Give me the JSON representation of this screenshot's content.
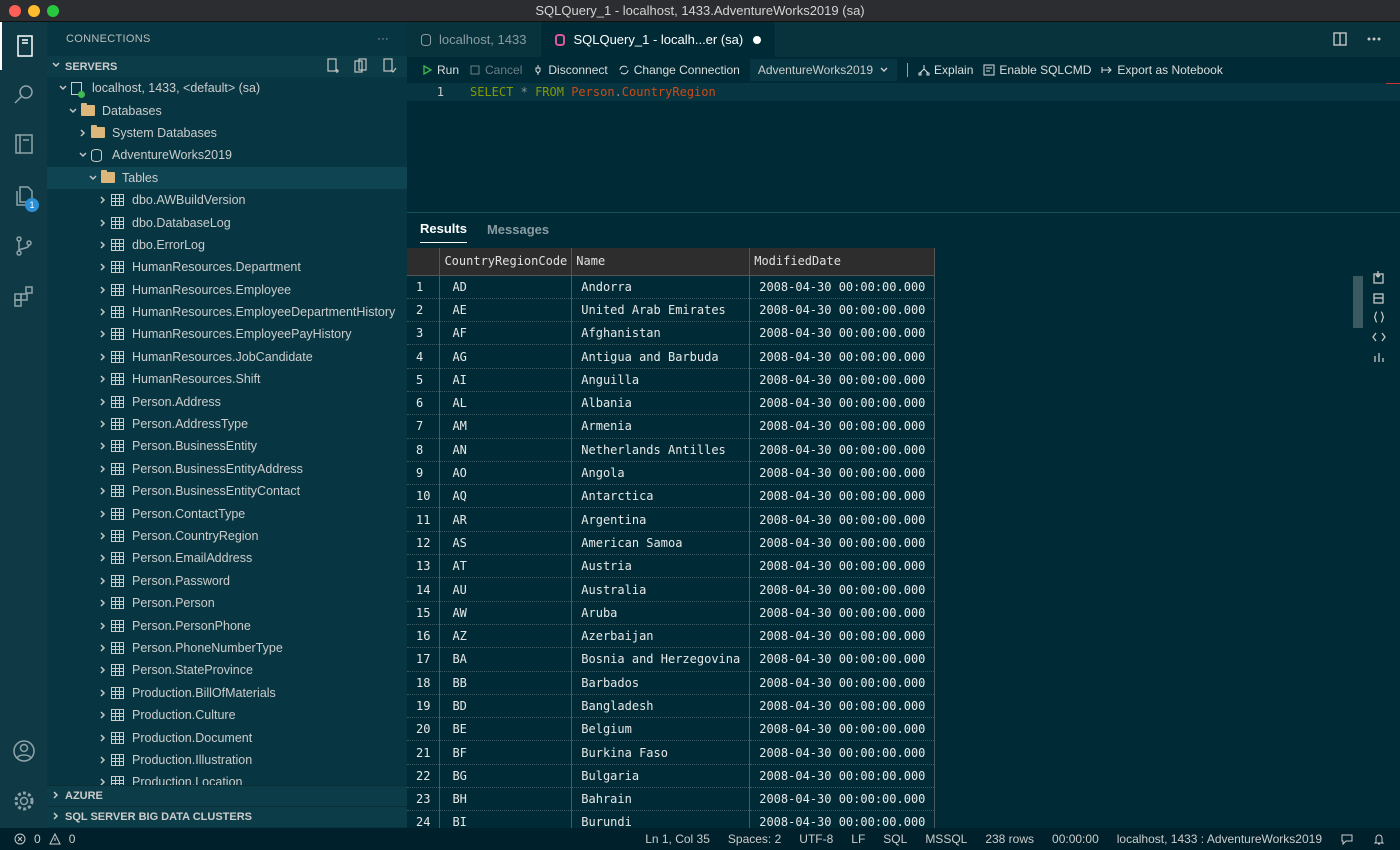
{
  "window": {
    "title": "SQLQuery_1 - localhost, 1433.AdventureWorks2019 (sa)"
  },
  "activity_bar": {
    "items": [
      {
        "name": "connections",
        "icon": "server-icon"
      },
      {
        "name": "search",
        "icon": "search-icon"
      },
      {
        "name": "notebooks",
        "icon": "notebook-icon"
      },
      {
        "name": "explorer",
        "icon": "files-icon",
        "badge": "1"
      },
      {
        "name": "source-control",
        "icon": "source-control-icon"
      },
      {
        "name": "extensions",
        "icon": "extensions-icon"
      }
    ],
    "bottom": [
      {
        "name": "accounts",
        "icon": "account-icon"
      },
      {
        "name": "manage",
        "icon": "gear-icon"
      }
    ]
  },
  "sidebar": {
    "title": "CONNECTIONS",
    "more": "···",
    "servers_label": "SERVERS",
    "tree": [
      {
        "level": 0,
        "twisty": "open",
        "icon": "server",
        "label": "localhost, 1433, <default> (sa)"
      },
      {
        "level": 1,
        "twisty": "open",
        "icon": "folder",
        "label": "Databases"
      },
      {
        "level": 2,
        "twisty": "closed",
        "icon": "folder",
        "label": "System Databases"
      },
      {
        "level": 2,
        "twisty": "open",
        "icon": "db",
        "label": "AdventureWorks2019"
      },
      {
        "level": 3,
        "twisty": "open",
        "icon": "folder",
        "label": "Tables",
        "selected": true
      },
      {
        "level": 4,
        "twisty": "closed",
        "icon": "table",
        "label": "dbo.AWBuildVersion"
      },
      {
        "level": 4,
        "twisty": "closed",
        "icon": "table",
        "label": "dbo.DatabaseLog"
      },
      {
        "level": 4,
        "twisty": "closed",
        "icon": "table",
        "label": "dbo.ErrorLog"
      },
      {
        "level": 4,
        "twisty": "closed",
        "icon": "table",
        "label": "HumanResources.Department"
      },
      {
        "level": 4,
        "twisty": "closed",
        "icon": "table",
        "label": "HumanResources.Employee"
      },
      {
        "level": 4,
        "twisty": "closed",
        "icon": "table",
        "label": "HumanResources.EmployeeDepartmentHistory"
      },
      {
        "level": 4,
        "twisty": "closed",
        "icon": "table",
        "label": "HumanResources.EmployeePayHistory"
      },
      {
        "level": 4,
        "twisty": "closed",
        "icon": "table",
        "label": "HumanResources.JobCandidate"
      },
      {
        "level": 4,
        "twisty": "closed",
        "icon": "table",
        "label": "HumanResources.Shift"
      },
      {
        "level": 4,
        "twisty": "closed",
        "icon": "table",
        "label": "Person.Address"
      },
      {
        "level": 4,
        "twisty": "closed",
        "icon": "table",
        "label": "Person.AddressType"
      },
      {
        "level": 4,
        "twisty": "closed",
        "icon": "table",
        "label": "Person.BusinessEntity"
      },
      {
        "level": 4,
        "twisty": "closed",
        "icon": "table",
        "label": "Person.BusinessEntityAddress"
      },
      {
        "level": 4,
        "twisty": "closed",
        "icon": "table",
        "label": "Person.BusinessEntityContact"
      },
      {
        "level": 4,
        "twisty": "closed",
        "icon": "table",
        "label": "Person.ContactType"
      },
      {
        "level": 4,
        "twisty": "closed",
        "icon": "table",
        "label": "Person.CountryRegion"
      },
      {
        "level": 4,
        "twisty": "closed",
        "icon": "table",
        "label": "Person.EmailAddress"
      },
      {
        "level": 4,
        "twisty": "closed",
        "icon": "table",
        "label": "Person.Password"
      },
      {
        "level": 4,
        "twisty": "closed",
        "icon": "table",
        "label": "Person.Person"
      },
      {
        "level": 4,
        "twisty": "closed",
        "icon": "table",
        "label": "Person.PersonPhone"
      },
      {
        "level": 4,
        "twisty": "closed",
        "icon": "table",
        "label": "Person.PhoneNumberType"
      },
      {
        "level": 4,
        "twisty": "closed",
        "icon": "table",
        "label": "Person.StateProvince"
      },
      {
        "level": 4,
        "twisty": "closed",
        "icon": "table",
        "label": "Production.BillOfMaterials"
      },
      {
        "level": 4,
        "twisty": "closed",
        "icon": "table",
        "label": "Production.Culture"
      },
      {
        "level": 4,
        "twisty": "closed",
        "icon": "table",
        "label": "Production.Document"
      },
      {
        "level": 4,
        "twisty": "closed",
        "icon": "table",
        "label": "Production.Illustration"
      },
      {
        "level": 4,
        "twisty": "closed",
        "icon": "table",
        "label": "Production.Location"
      }
    ],
    "azure_label": "AZURE",
    "bdc_label": "SQL SERVER BIG DATA CLUSTERS"
  },
  "editor": {
    "tabs": [
      {
        "label": "localhost, 1433",
        "active": false
      },
      {
        "label": "SQLQuery_1 - localh...er (sa)",
        "active": true,
        "dirty": true
      }
    ],
    "toolbar": {
      "run": "Run",
      "cancel": "Cancel",
      "disconnect": "Disconnect",
      "change_connection": "Change Connection",
      "database": "AdventureWorks2019",
      "explain": "Explain",
      "sqlcmd": "Enable SQLCMD",
      "export": "Export as Notebook"
    },
    "code": {
      "line_number": "1",
      "select": "SELECT",
      "star": "*",
      "from": "FROM",
      "schema": "Person",
      "dot": ".",
      "table": "CountryRegion"
    }
  },
  "results": {
    "tabs": [
      "Results",
      "Messages"
    ],
    "columns": [
      "CountryRegionCode",
      "Name",
      "ModifiedDate"
    ],
    "rows": [
      [
        "1",
        "AD",
        "Andorra",
        "2008-04-30 00:00:00.000"
      ],
      [
        "2",
        "AE",
        "United Arab Emirates",
        "2008-04-30 00:00:00.000"
      ],
      [
        "3",
        "AF",
        "Afghanistan",
        "2008-04-30 00:00:00.000"
      ],
      [
        "4",
        "AG",
        "Antigua and Barbuda",
        "2008-04-30 00:00:00.000"
      ],
      [
        "5",
        "AI",
        "Anguilla",
        "2008-04-30 00:00:00.000"
      ],
      [
        "6",
        "AL",
        "Albania",
        "2008-04-30 00:00:00.000"
      ],
      [
        "7",
        "AM",
        "Armenia",
        "2008-04-30 00:00:00.000"
      ],
      [
        "8",
        "AN",
        "Netherlands Antilles",
        "2008-04-30 00:00:00.000"
      ],
      [
        "9",
        "AO",
        "Angola",
        "2008-04-30 00:00:00.000"
      ],
      [
        "10",
        "AQ",
        "Antarctica",
        "2008-04-30 00:00:00.000"
      ],
      [
        "11",
        "AR",
        "Argentina",
        "2008-04-30 00:00:00.000"
      ],
      [
        "12",
        "AS",
        "American Samoa",
        "2008-04-30 00:00:00.000"
      ],
      [
        "13",
        "AT",
        "Austria",
        "2008-04-30 00:00:00.000"
      ],
      [
        "14",
        "AU",
        "Australia",
        "2008-04-30 00:00:00.000"
      ],
      [
        "15",
        "AW",
        "Aruba",
        "2008-04-30 00:00:00.000"
      ],
      [
        "16",
        "AZ",
        "Azerbaijan",
        "2008-04-30 00:00:00.000"
      ],
      [
        "17",
        "BA",
        "Bosnia and Herzegovina",
        "2008-04-30 00:00:00.000"
      ],
      [
        "18",
        "BB",
        "Barbados",
        "2008-04-30 00:00:00.000"
      ],
      [
        "19",
        "BD",
        "Bangladesh",
        "2008-04-30 00:00:00.000"
      ],
      [
        "20",
        "BE",
        "Belgium",
        "2008-04-30 00:00:00.000"
      ],
      [
        "21",
        "BF",
        "Burkina Faso",
        "2008-04-30 00:00:00.000"
      ],
      [
        "22",
        "BG",
        "Bulgaria",
        "2008-04-30 00:00:00.000"
      ],
      [
        "23",
        "BH",
        "Bahrain",
        "2008-04-30 00:00:00.000"
      ],
      [
        "24",
        "BI",
        "Burundi",
        "2008-04-30 00:00:00.000"
      ]
    ]
  },
  "status_bar": {
    "errors": "0",
    "warnings": "0",
    "position": "Ln 1, Col 35",
    "spaces": "Spaces: 2",
    "encoding": "UTF-8",
    "eol": "LF",
    "language": "SQL",
    "provider": "MSSQL",
    "rows": "238 rows",
    "elapsed": "00:00:00",
    "connection": "localhost, 1433 : AdventureWorks2019"
  },
  "colors": {
    "editor_bg": "#002b36",
    "sidebar_bg": "#073642",
    "activity_bg": "#0f3a45",
    "keyword": "#859900",
    "identifier": "#cb4b16"
  }
}
